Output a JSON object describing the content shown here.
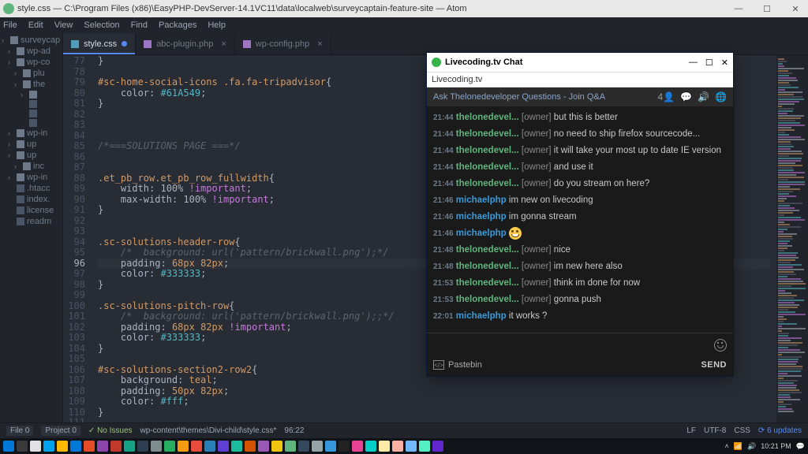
{
  "window": {
    "title": "style.css — C:\\Program Files (x86)\\EasyPHP-DevServer-14.1VC11\\data\\localweb\\surveycaptain-feature-site — Atom",
    "min": "—",
    "max": "☐",
    "close": "✕"
  },
  "menu": [
    "File",
    "Edit",
    "View",
    "Selection",
    "Find",
    "Packages",
    "Help"
  ],
  "sidebar": {
    "root": "surveycap",
    "items": [
      "wp-ad",
      "wp-co",
      "plu",
      "the",
      "",
      "",
      "",
      "",
      "wp-in",
      "up",
      "up",
      "inc",
      "wp-in",
      ".htacc",
      "index.",
      "license",
      "readm"
    ]
  },
  "tabs": [
    {
      "label": "style.css",
      "active": true,
      "modified": true,
      "type": "css"
    },
    {
      "label": "abc-plugin.php",
      "active": false,
      "type": "php"
    },
    {
      "label": "wp-config.php",
      "active": false,
      "type": "php"
    }
  ],
  "code": {
    "first_line_no": 77,
    "cursor_line_idx": 19,
    "lines": [
      "}",
      "",
      "#sc-home-social-icons .fa.fa-tripadvisor{",
      "    color: #61A549;",
      "}",
      "",
      "",
      "",
      "/*===SOLUTIONS PAGE ===*/",
      "",
      "",
      ".et_pb_row.et_pb_row_fullwidth{",
      "    width: 100% !important;",
      "    max-width: 100% !important;",
      "}",
      "",
      "",
      ".sc-solutions-header-row{",
      "    /*  background: url('pattern/brickwall.png');*/",
      "    padding: 68px 82px;",
      "    color: #333333;",
      "}",
      "",
      ".sc-solutions-pitch-row{",
      "    /*  background: url('pattern/brickwall.png');;*/",
      "    padding: 68px 82px !important;",
      "    color: #333333;",
      "}",
      "",
      "#sc-solutions-section2-row2{",
      "    background: teal;",
      "    padding: 50px 82px;",
      "    color: #fff;",
      "}",
      ""
    ]
  },
  "status": {
    "file_chip": "File 0",
    "project_chip": "Project 0",
    "issues": "✓ No Issues",
    "path": "wp-content\\themes\\Divi-child\\style.css*",
    "cursor": "96:22",
    "lf": "LF",
    "enc": "UTF-8",
    "lang": "CSS",
    "updates": "⟳ 6 updates"
  },
  "chat": {
    "title": "Livecoding.tv Chat",
    "subtitle": "Livecoding.tv",
    "ask": "Ask Thelonedeveloper Questions - Join Q&A",
    "owner_tag": "[owner]",
    "messages": [
      {
        "ts": "21:44",
        "user": "thelonedevel...",
        "owner": true,
        "text": "but this is better"
      },
      {
        "ts": "21:44",
        "user": "thelonedevel...",
        "owner": true,
        "text": "no need to ship firefox sourcecode..."
      },
      {
        "ts": "21:44",
        "user": "thelonedevel...",
        "owner": true,
        "text": "it will take your most up to date IE version"
      },
      {
        "ts": "21:44",
        "user": "thelonedevel...",
        "owner": true,
        "text": "and use it"
      },
      {
        "ts": "21:44",
        "user": "thelonedevel...",
        "owner": true,
        "text": "do you stream on here?"
      },
      {
        "ts": "21:46",
        "user": "michaelphp",
        "owner": false,
        "text": "im new on livecoding"
      },
      {
        "ts": "21:46",
        "user": "michaelphp",
        "owner": false,
        "text": "im gonna stream"
      },
      {
        "ts": "21:46",
        "user": "michaelphp",
        "owner": false,
        "emoji": true
      },
      {
        "ts": "21:48",
        "user": "thelonedevel...",
        "owner": true,
        "text": "nice"
      },
      {
        "ts": "21:48",
        "user": "thelonedevel...",
        "owner": true,
        "text": "im new here also"
      },
      {
        "ts": "21:53",
        "user": "thelonedevel...",
        "owner": true,
        "text": "think im done for now"
      },
      {
        "ts": "21:53",
        "user": "thelonedevel...",
        "owner": true,
        "text": "gonna push"
      },
      {
        "ts": "22:01",
        "user": "michaelphp",
        "owner": false,
        "text": "it works ?"
      }
    ],
    "pastebin": "Pastebin",
    "send": "SEND"
  },
  "taskbar": {
    "icons": [
      "#0078d7",
      "#3a3a3a",
      "#e1e1e1",
      "#00a2ed",
      "#ffb900",
      "#0078d7",
      "#e34c26",
      "#8e44ad",
      "#c0392b",
      "#16a085",
      "#2c3e50",
      "#7f8c8d",
      "#27ae60",
      "#f39c12",
      "#e74c3c",
      "#2980b9",
      "#5d3fd3",
      "#1abc9c",
      "#d35400",
      "#9b59b6",
      "#f1c40f",
      "#5fb57d",
      "#34495e",
      "#95a5a6",
      "#3498db",
      "#222",
      "#e84393",
      "#00cec9",
      "#ffeaa7",
      "#fab1a0",
      "#74b9ff",
      "#55efc4",
      "#5f27cd"
    ],
    "time": "10:21 PM"
  }
}
